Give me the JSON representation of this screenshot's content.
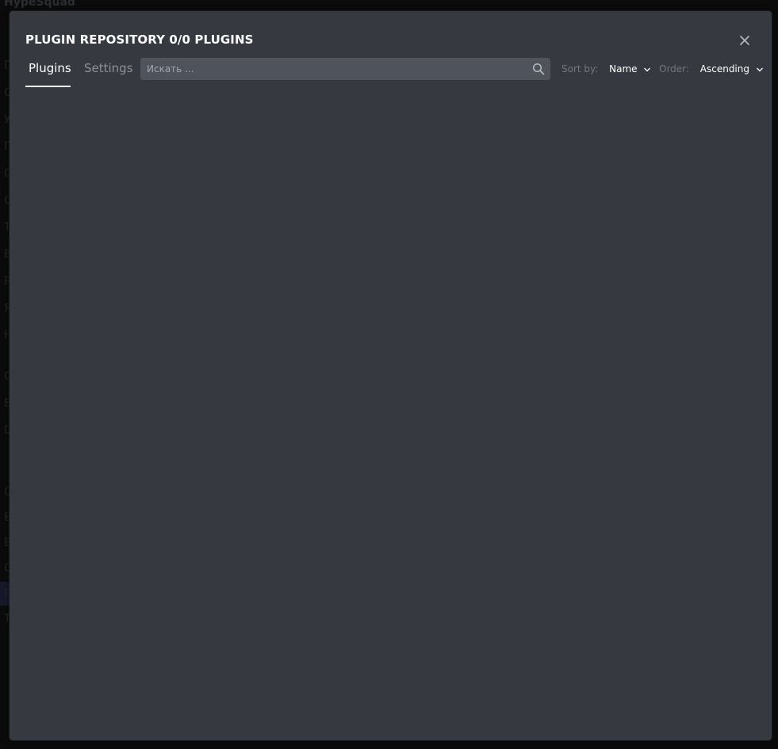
{
  "background": {
    "heading": "HypeSquad",
    "side_letters": [
      "Г",
      "С",
      "У",
      "П",
      "О",
      "С",
      "Т",
      "В",
      "Р",
      "Я",
      "Н",
      "О",
      "В",
      "D",
      "О",
      "В",
      "В",
      "О",
      "Р",
      "Т"
    ]
  },
  "modal": {
    "title": "PLUGIN REPOSITORY 0/0 PLUGINS",
    "close_icon": "close-icon",
    "tabs": [
      {
        "label": "Plugins",
        "active": true
      },
      {
        "label": "Settings",
        "active": false
      }
    ],
    "search": {
      "placeholder": "Искать ...",
      "value": "",
      "icon": "search-icon"
    },
    "sort": {
      "label": "Sort by:",
      "value": "Name"
    },
    "order": {
      "label": "Order:",
      "value": "Ascending"
    }
  },
  "colors": {
    "modal_bg": "#36393f",
    "search_bg": "#4f545c",
    "active_tab": "#ffffff",
    "inactive_tab": "#8e9297",
    "muted_label": "#72767d"
  }
}
